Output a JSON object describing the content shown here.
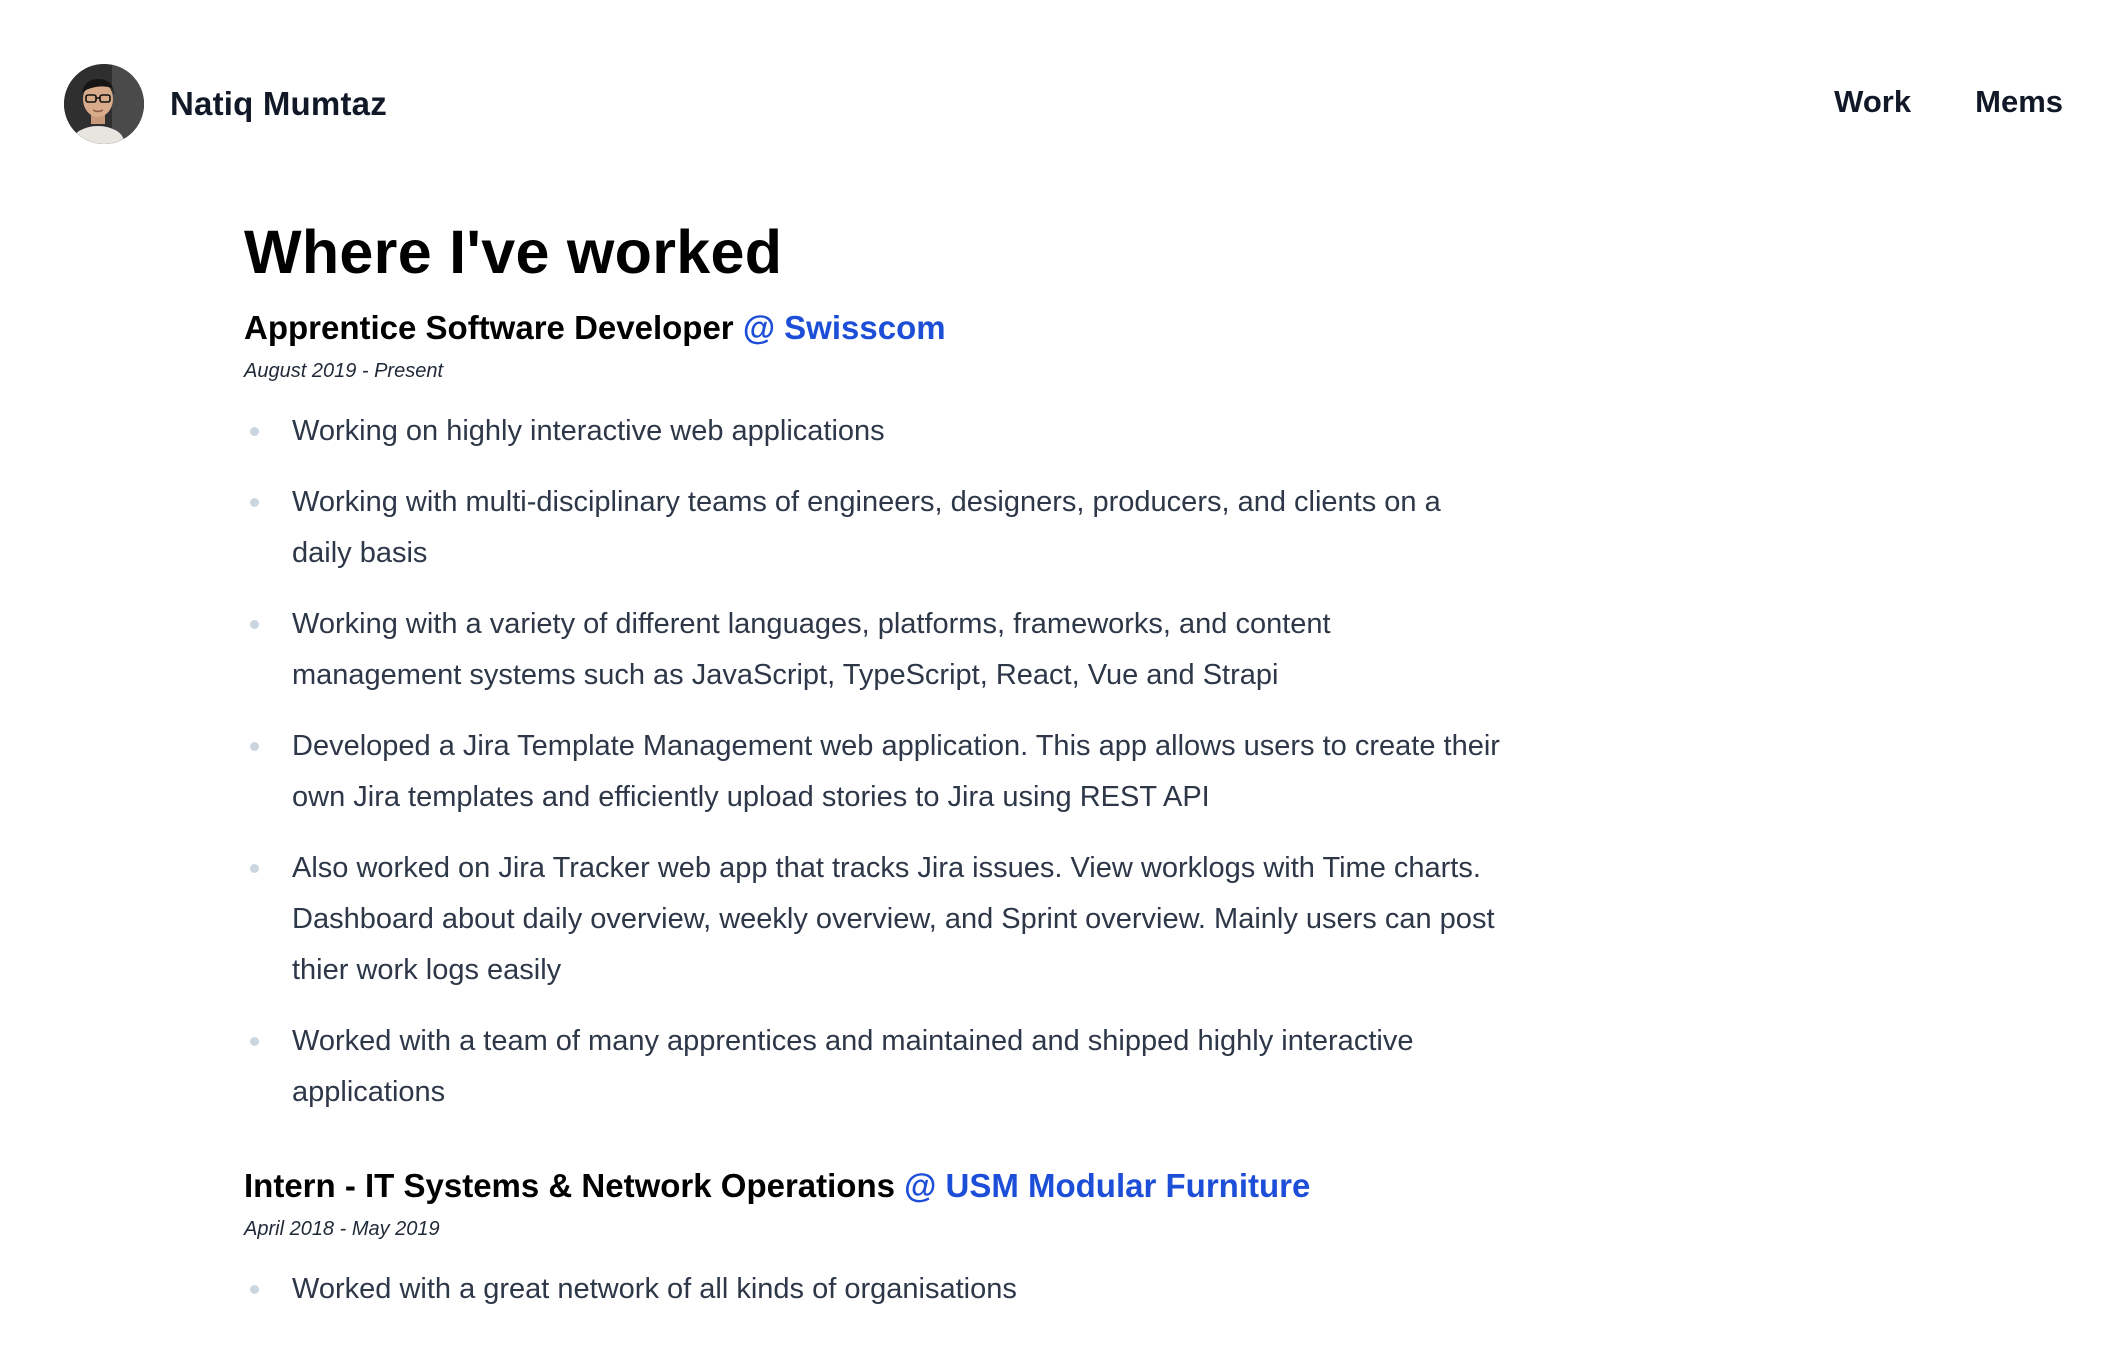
{
  "header": {
    "name": "Natiq Mumtaz",
    "nav": [
      "Work",
      "Mems"
    ]
  },
  "main": {
    "section_title": "Where I've worked",
    "jobs": [
      {
        "role": "Apprentice Software Developer",
        "company": "@ Swisscom",
        "dates": "August 2019 - Present",
        "duties": [
          "Working on highly interactive web applications",
          "Working with multi-disciplinary teams of engineers, designers, producers, and clients on a daily basis",
          "Working with a variety of different languages, platforms, frameworks, and content management systems such as JavaScript, TypeScript, React, Vue and Strapi",
          "Developed a Jira Template Management web application. This app allows users to create their own Jira templates and efficiently upload stories to Jira using REST API",
          "Also worked on Jira Tracker web app that tracks Jira issues. View worklogs with Time charts. Dashboard about daily overview, weekly overview, and Sprint overview. Mainly users can post thier work logs easily",
          "Worked with a team of many apprentices and maintained and shipped highly interactive applications"
        ]
      },
      {
        "role": "Intern - IT Systems & Network Operations",
        "company": "@ USM Modular Furniture",
        "dates": "April 2018 - May 2019",
        "duties": [
          "Worked with a great network of all kinds of organisations"
        ]
      }
    ]
  },
  "colors": {
    "accent": "#1d4ed8",
    "bullet": "#cbd5e0",
    "text": "#2d3748"
  }
}
